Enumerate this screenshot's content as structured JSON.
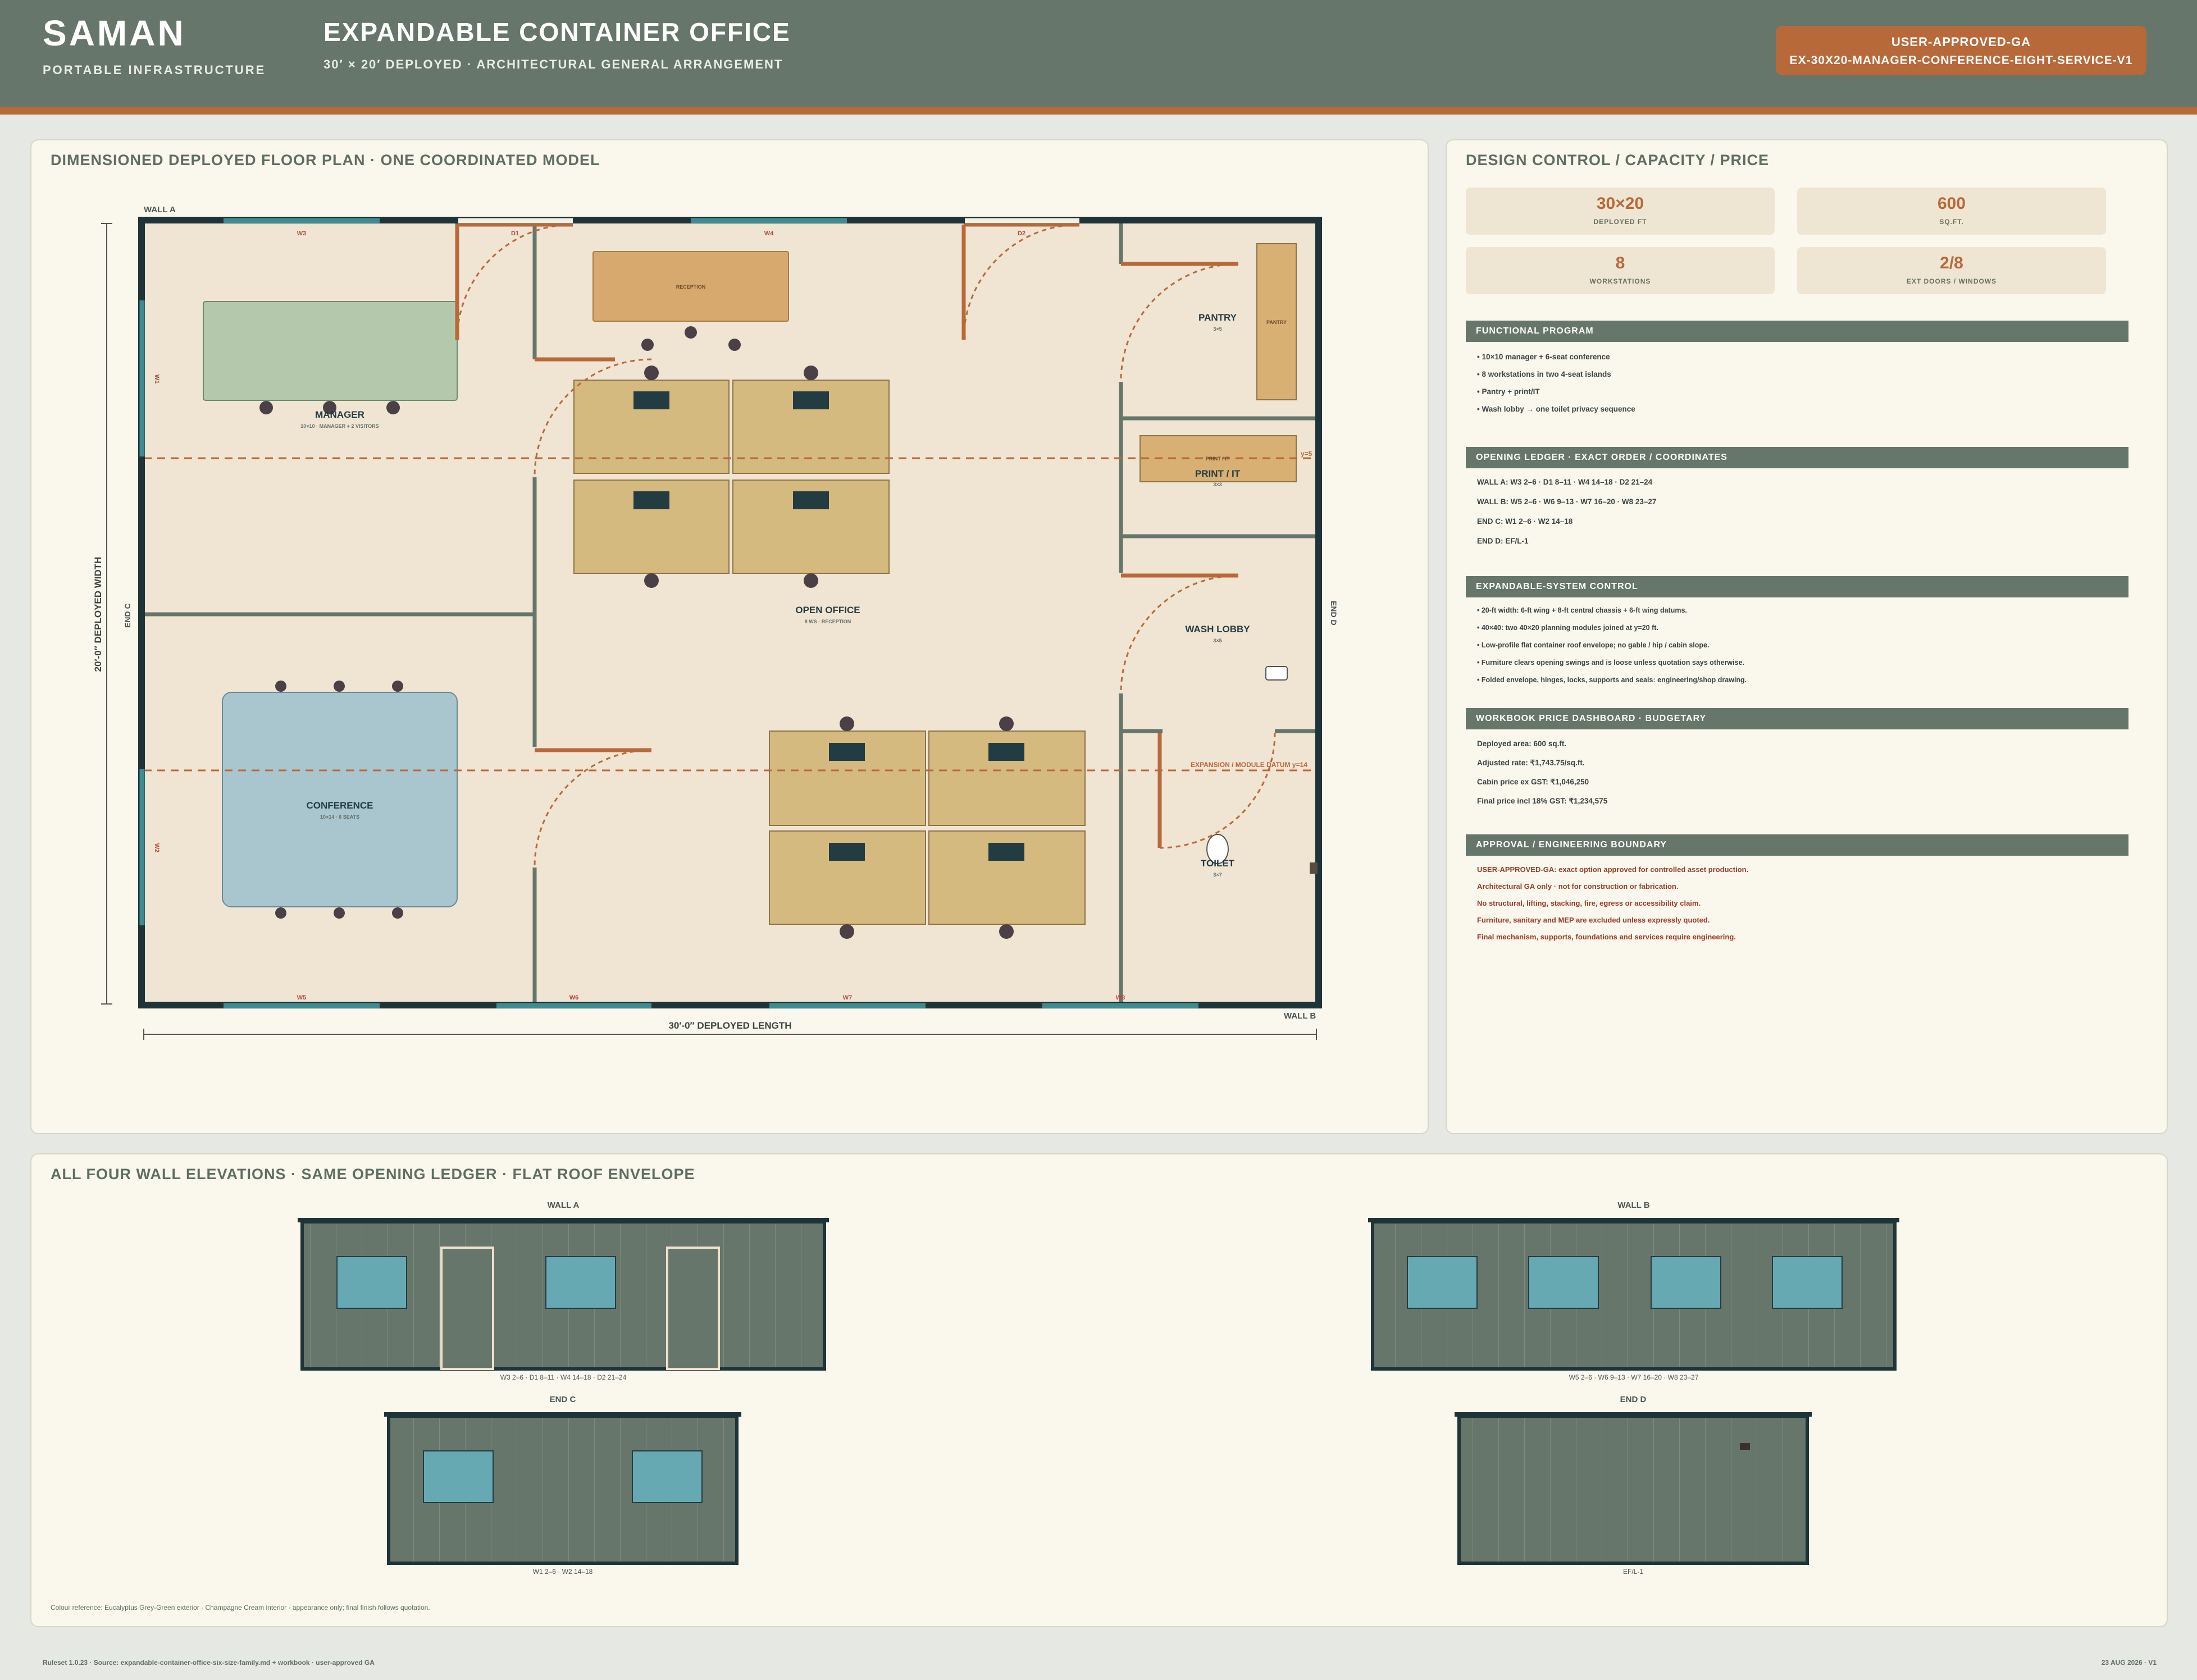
{
  "header": {
    "brand": "SAMAN",
    "brand_sub": "PORTABLE INFRASTRUCTURE",
    "title": "EXPANDABLE CONTAINER OFFICE",
    "subtitle": "30′ × 20′ DEPLOYED · ARCHITECTURAL GENERAL ARRANGEMENT",
    "badge_status": "USER-APPROVED-GA",
    "badge_code": "EX-30X20-MANAGER-CONFERENCE-EIGHT-SERVICE-V1"
  },
  "plan": {
    "card_title": "DIMENSIONED DEPLOYED FLOOR PLAN · ONE COORDINATED MODEL",
    "wall_a": "WALL A",
    "wall_b": "WALL B",
    "end_c": "END C",
    "end_d": "END D",
    "width_dim": "20′-0″ DEPLOYED WIDTH",
    "length_dim": "30′-0″ DEPLOYED LENGTH",
    "openings": {
      "w3": "W3",
      "d1": "D1",
      "w4": "W4",
      "d2": "D2",
      "w5": "W5",
      "w6": "W6",
      "w7": "W7",
      "w8": "W8",
      "w1": "W1",
      "w2": "W2",
      "ef": "EF"
    },
    "rooms": {
      "manager": "MANAGER",
      "manager_sub": "10×10 · MANAGER + 2 VISITORS",
      "conference": "CONFERENCE",
      "conference_sub": "10×14 · 6 SEATS",
      "conference_table": "CONFERENCE",
      "reception": "RECEPTION",
      "open_office": "OPEN OFFICE",
      "open_office_sub": "8 WS · RECEPTION",
      "pantry": "PANTRY",
      "pantry_sub": "3×5",
      "pantry_counter": "PANTRY",
      "print_it": "PRINT / IT",
      "print_it_sub": "3×3",
      "print_counter": "PRINT / IT",
      "wash_lobby": "WASH LOBBY",
      "wash_lobby_sub": "3×5",
      "toilet": "TOILET",
      "toilet_sub": "3×7"
    },
    "datum_label": "EXPANSION / MODULE DATUM y=14",
    "datum_label_short": "y=5"
  },
  "control": {
    "card_title": "DESIGN CONTROL / CAPACITY / PRICE",
    "kpis": [
      {
        "value": "30×20",
        "label": "DEPLOYED FT"
      },
      {
        "value": "600",
        "label": "SQ.FT."
      },
      {
        "value": "8",
        "label": "WORKSTATIONS"
      },
      {
        "value": "2/8",
        "label": "EXT DOORS / WINDOWS"
      }
    ],
    "functional_title": "FUNCTIONAL PROGRAM",
    "functional": [
      "• 10×10 manager + 6-seat conference",
      "• 8 workstations in two 4-seat islands",
      "• Pantry + print/IT",
      "• Wash lobby → one toilet privacy sequence"
    ],
    "ledger_title": "OPENING LEDGER · EXACT ORDER / COORDINATES",
    "ledger": [
      "WALL A: W3 2–6 · D1 8–11 · W4 14–18 · D2 21–24",
      "WALL B: W5 2–6 · W6 9–13 · W7 16–20 · W8 23–27",
      "END C: W1 2–6 · W2 14–18",
      "END D: EF/L-1"
    ],
    "system_title": "EXPANDABLE-SYSTEM CONTROL",
    "system": [
      "• 20-ft width: 6-ft wing + 8-ft central chassis + 6-ft wing datums.",
      "• 40×40: two 40×20 planning modules joined at y=20 ft.",
      "• Low-profile flat container roof envelope; no gable / hip / cabin slope.",
      "• Furniture clears opening swings and is loose unless quotation says otherwise.",
      "• Folded envelope, hinges, locks, supports and seals: engineering/shop drawing."
    ],
    "price_title": "WORKBOOK PRICE DASHBOARD · BUDGETARY",
    "price": [
      "Deployed area: 600 sq.ft.",
      "Adjusted rate: ₹1,743.75/sq.ft.",
      "Cabin price ex GST: ₹1,046,250",
      "Final price incl 18% GST: ₹1,234,575"
    ],
    "approval_title": "APPROVAL / ENGINEERING BOUNDARY",
    "approval": [
      "USER-APPROVED-GA: exact option approved for controlled asset production.",
      "Architectural GA only · not for construction or fabrication.",
      "No structural, lifting, stacking, fire, egress or accessibility claim.",
      "Furniture, sanitary and MEP are excluded unless expressly quoted.",
      "Final mechanism, supports, foundations and services require engineering."
    ]
  },
  "elevations": {
    "card_title": "ALL FOUR WALL ELEVATIONS · SAME OPENING LEDGER · FLAT ROOF ENVELOPE",
    "wall_a": {
      "label": "WALL A",
      "caption": "W3 2–6 · D1 8–11 · W4 14–18 · D2 21–24"
    },
    "wall_b": {
      "label": "WALL B",
      "caption": "W5 2–6 · W6 9–13 · W7 16–20 · W8 23–27"
    },
    "end_c": {
      "label": "END C",
      "caption": "W1 2–6 · W2 14–18"
    },
    "end_d": {
      "label": "END D",
      "caption": "EF/L-1"
    },
    "colour_note": "Colour reference: Eucalyptus Grey-Green exterior · Champagne Cream interior · appearance only; final finish follows quotation."
  },
  "footer": {
    "left": "Ruleset 1.0.23 · Source: expandable-container-office-six-size-family.md + workbook · user-approved GA",
    "right": "23 AUG 2026 · V1"
  },
  "colors": {
    "header": "#66766a",
    "accent": "#b8693a",
    "wall": "#1f3438",
    "window": "#3e8b93",
    "floor": "#f0e4d3",
    "desk": "#d5ba80",
    "manager_room": "#b4c9ab",
    "conference_table": "#a9c6ce",
    "panel": "#66766a"
  }
}
